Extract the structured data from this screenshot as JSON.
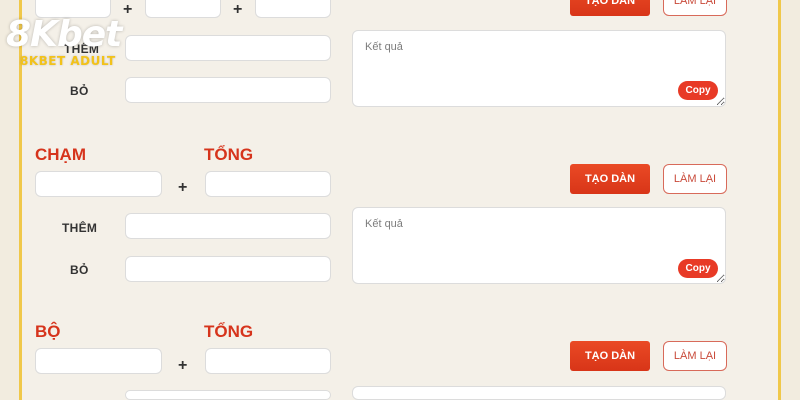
{
  "brand": {
    "logo_text": "8Kbet",
    "logo_sub": "8KBET ADULT"
  },
  "common": {
    "plus": "+",
    "generate_label": "TẠO DÀN",
    "reset_label": "LÀM LẠI",
    "result_placeholder": "Kết quả",
    "copy_label": "Copy",
    "add_label": "THÊM",
    "remove_label": "BỎ"
  },
  "section_top": {
    "add_label": "THÊM",
    "remove_label": "BỎ"
  },
  "section_cham": {
    "title_left": "CHẠM",
    "title_right": "TỔNG"
  },
  "section_bo": {
    "title_left": "BỘ",
    "title_right": "TỔNG"
  },
  "colors": {
    "accent": "#e83a26",
    "heading": "#d6341c",
    "background": "#f4f0e8",
    "border_gold": "#f0c84a"
  }
}
